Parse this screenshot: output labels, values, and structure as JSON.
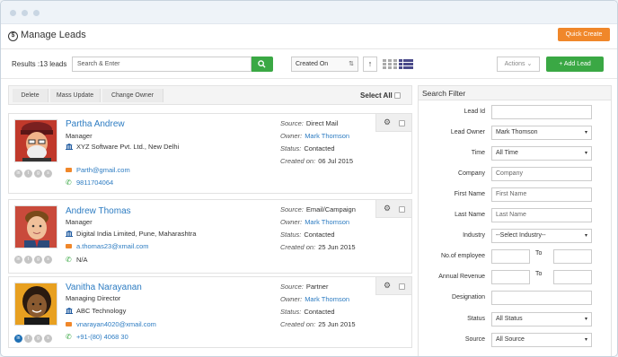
{
  "header": {
    "title": "Manage Leads",
    "quick_create": "Quick Create"
  },
  "toolbar": {
    "results": "Results :13 leads",
    "search_placeholder": "Search & Enter",
    "sort_value": "Created On",
    "sort_dir": "↑",
    "actions_label": "Actions",
    "add_lead": "+ Add Lead"
  },
  "bulk": {
    "delete": "Delete",
    "mass_update": "Mass Update",
    "change_owner": "Change Owner",
    "select_all": "Select All"
  },
  "labels": {
    "source": "Source:",
    "owner": "Owner:",
    "status": "Status:",
    "created_on": "Created on:"
  },
  "leads": [
    {
      "name": "Partha Andrew",
      "role": "Manager",
      "company": "XYZ Software Pvt. Ltd., New Delhi",
      "email": "Parth@gmail.com",
      "phone": "9811704064",
      "source": "Direct Mail",
      "owner": "Mark Thomson",
      "status": "Contacted",
      "created_on": "06 Jul 2015"
    },
    {
      "name": "Andrew Thomas",
      "role": "Manager",
      "company": "Digital India Limited, Pune, Maharashtra",
      "email": "a.thomas23@xmail.com",
      "phone": "N/A",
      "source": "Email/Campaign",
      "owner": "Mark Thomson",
      "status": "Contacted",
      "created_on": "25 Jun 2015"
    },
    {
      "name": "Vanitha Narayanan",
      "role": "Managing Director",
      "company": "ABC Technology",
      "email": "vnarayan4020@xmail.com",
      "phone": "+91-(80) 4068 30",
      "source": "Partner",
      "owner": "Mark Thomson",
      "status": "Contacted",
      "created_on": "25 Jun 2015"
    }
  ],
  "filter": {
    "title": "Search Filter",
    "lead_id": "Lead Id",
    "lead_owner": "Lead Owner",
    "lead_owner_value": "Mark Thomson",
    "time": "Time",
    "time_value": "All Time",
    "company": "Company",
    "company_ph": "Company",
    "first_name": "First Name",
    "first_name_ph": "First Name",
    "last_name": "Last Name",
    "last_name_ph": "Last Name",
    "industry": "Industry",
    "industry_value": "--Select Industry--",
    "employees": "No.of employee",
    "revenue": "Annual Revenue",
    "to": "To",
    "designation": "Designation",
    "status": "Status",
    "status_value": "All Status",
    "source": "Source",
    "source_value": "All Source"
  },
  "icons": [
    "dollar-icon",
    "search-icon",
    "grid-view-icon",
    "list-view-icon",
    "gear-icon",
    "building-icon",
    "mail-icon",
    "phone-icon",
    "linkedin-icon",
    "twitter-icon",
    "google-icon",
    "skype-icon"
  ]
}
